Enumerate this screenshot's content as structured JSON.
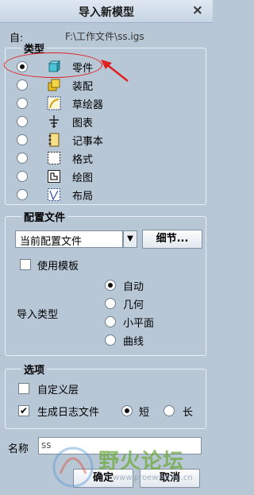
{
  "window": {
    "title": "导入新模型",
    "close_glyph": "×"
  },
  "from": {
    "label": "自:",
    "path": "F:\\工作文件\\ss.igs"
  },
  "type_group": {
    "label": "类型",
    "options": [
      {
        "label": "零件",
        "icon": "part-icon",
        "selected": true
      },
      {
        "label": "装配",
        "icon": "assembly-icon",
        "selected": false
      },
      {
        "label": "草绘器",
        "icon": "sketch-icon",
        "selected": false
      },
      {
        "label": "图表",
        "icon": "diagram-icon",
        "selected": false
      },
      {
        "label": "记事本",
        "icon": "notebook-icon",
        "selected": false
      },
      {
        "label": "格式",
        "icon": "format-icon",
        "selected": false
      },
      {
        "label": "绘图",
        "icon": "drawing-icon",
        "selected": false
      },
      {
        "label": "布局",
        "icon": "layout-icon",
        "selected": false
      }
    ]
  },
  "config_group": {
    "label": "配置文件",
    "profile_select": "当前配置文件",
    "detail_button": "细节...",
    "use_template": {
      "label": "使用模板",
      "checked": false
    },
    "import_type_label": "导入类型",
    "import_types": [
      {
        "label": "自动",
        "selected": true
      },
      {
        "label": "几何",
        "selected": false
      },
      {
        "label": "小平面",
        "selected": false
      },
      {
        "label": "曲线",
        "selected": false
      }
    ]
  },
  "options_group": {
    "label": "选项",
    "custom_layer": {
      "label": "自定义层",
      "checked": false
    },
    "generate_log": {
      "label": "生成日志文件",
      "checked": true
    },
    "log_short": {
      "label": "短",
      "selected": true
    },
    "log_long": {
      "label": "长",
      "selected": false
    }
  },
  "name": {
    "label": "名称",
    "value": "ss"
  },
  "buttons": {
    "ok": "确定",
    "cancel": "取消"
  },
  "watermark": {
    "text": "野火论坛",
    "url": "www.proewildfire.cn"
  },
  "colors": {
    "annotation": "#e02020",
    "dialog_bg": "#b8c7d6"
  }
}
